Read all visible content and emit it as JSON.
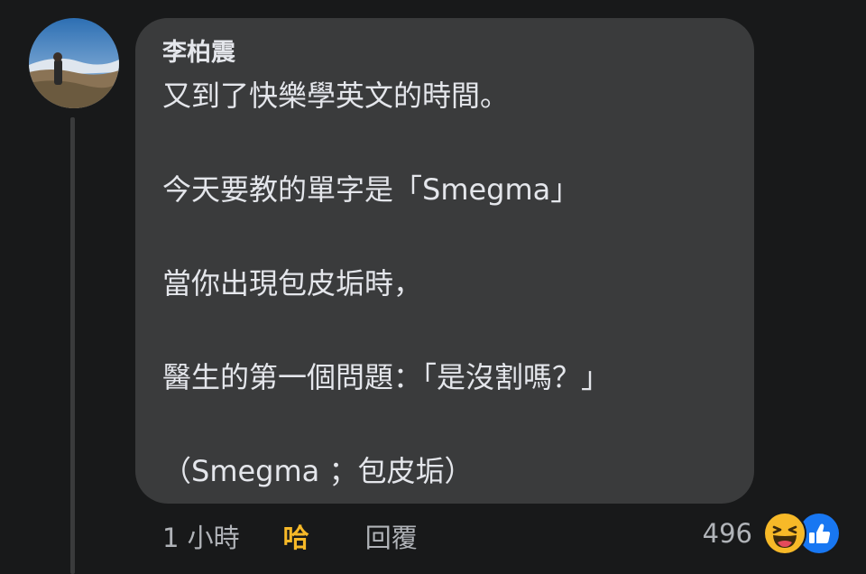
{
  "comment": {
    "author": "李柏震",
    "lines": [
      "又到了快樂學英文的時間。",
      "",
      "今天要教的單字是「Smegma」",
      "",
      "當你出現包皮垢時，",
      "",
      "醫生的第一個問題：「是沒割嗎？」",
      "",
      "（Smegma ；包皮垢）"
    ]
  },
  "footer": {
    "time": "1 小時",
    "reaction_label": "哈",
    "reply_label": "回覆"
  },
  "reactions": {
    "count": "496",
    "icons": [
      "haha-icon",
      "like-icon"
    ]
  },
  "colors": {
    "background": "#18191a",
    "bubble": "#3a3b3c",
    "text": "#e4e6eb",
    "muted": "#b0b3b8",
    "haha": "#f7b928",
    "like": "#1877f2"
  }
}
